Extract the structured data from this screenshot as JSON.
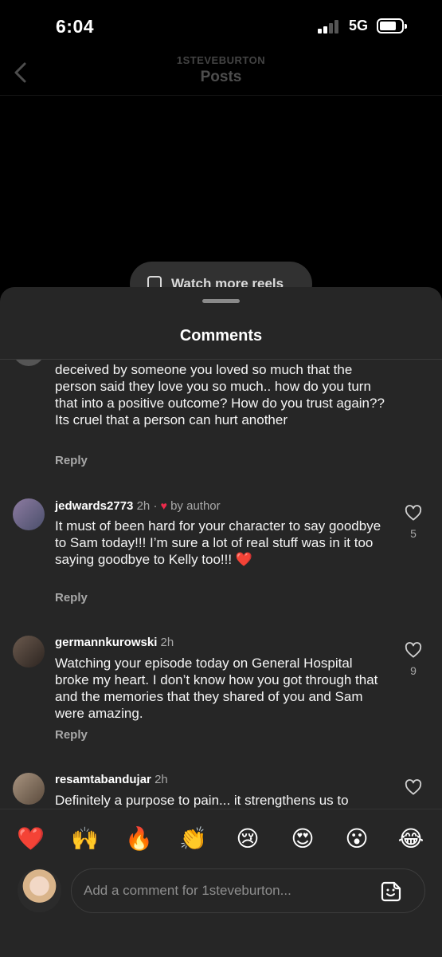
{
  "status_bar": {
    "time": "6:04",
    "network": "5G"
  },
  "header": {
    "username": "1STEVEBURTON",
    "title": "Posts"
  },
  "reels_pill": {
    "label": "Watch more reels"
  },
  "sheet": {
    "title": "Comments"
  },
  "comments": [
    {
      "username": "",
      "time": "",
      "body": "deceived by someone you loved so much that the person said they love you so much.. how do you turn that into a positive outcome? How do you trust again?? Its cruel that a person can hurt another",
      "reply_label": "Reply",
      "likes": ""
    },
    {
      "username": "jedwards2773",
      "time": "2h",
      "separator": "·",
      "liked_by": "by author",
      "body": "It must of been hard for your character to say goodbye to Sam today!!! I’m sure a lot of real stuff was in it too saying goodbye to Kelly too!!! ❤️",
      "reply_label": "Reply",
      "likes": "5"
    },
    {
      "username": "germannkurowski",
      "time": "2h",
      "body": "Watching your episode today on General Hospital broke my heart. I don’t know how you got through that and the memories that they shared of you and Sam were amazing.",
      "reply_label": "Reply",
      "likes": "9"
    },
    {
      "username": "resamtabandujar",
      "time": "2h",
      "body": "Definitely a purpose to pain... it strengthens us to",
      "reply_label": "",
      "likes": ""
    }
  ],
  "emoji_reactions": [
    "❤️",
    "🙌",
    "🔥",
    "👏",
    "😢",
    "😍",
    "😮",
    "😂"
  ],
  "composer": {
    "placeholder": "Add a comment for 1steveburton..."
  },
  "colors": {
    "sheet_bg": "#262626",
    "like_red": "#ed2a4b",
    "muted_text": "#a8a8a8"
  }
}
